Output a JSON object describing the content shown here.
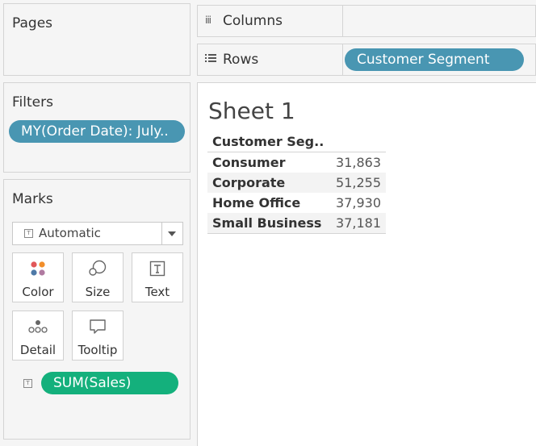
{
  "pages": {
    "title": "Pages"
  },
  "filters": {
    "title": "Filters",
    "items": [
      {
        "label": "MY(Order Date): July.."
      }
    ]
  },
  "marks": {
    "title": "Marks",
    "mark_type": "Automatic",
    "cards": {
      "color": "Color",
      "size": "Size",
      "text": "Text",
      "detail": "Detail",
      "tooltip": "Tooltip"
    },
    "fields": [
      {
        "label": "SUM(Sales)",
        "encoding": "text-icon",
        "color": "#14b07c"
      }
    ]
  },
  "shelves": {
    "columns": {
      "label": "Columns",
      "pills": []
    },
    "rows": {
      "label": "Rows",
      "pills": [
        {
          "label": "Customer Segment",
          "color": "#4996b2"
        }
      ]
    }
  },
  "sheet": {
    "title": "Sheet 1",
    "table": {
      "header": "Customer Seg..",
      "rows": [
        {
          "segment": "Consumer",
          "value": "31,863"
        },
        {
          "segment": "Corporate",
          "value": "51,255"
        },
        {
          "segment": "Home Office",
          "value": "37,930"
        },
        {
          "segment": "Small Business",
          "value": "37,181"
        }
      ]
    }
  },
  "colors": {
    "dimension_pill": "#4996b2",
    "measure_pill": "#14b07c",
    "panel_bg": "#f5f5f5",
    "border": "#d4d4d4"
  }
}
